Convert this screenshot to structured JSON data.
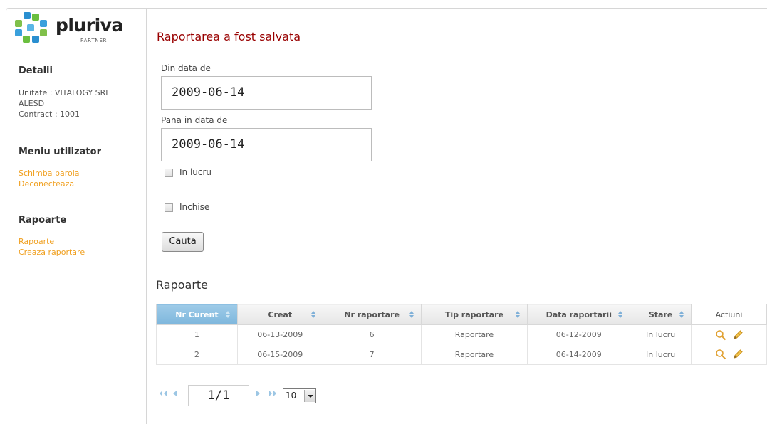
{
  "brand": {
    "name": "pluriva",
    "sub": "PARTNER"
  },
  "sidebar": {
    "details_heading": "Detalii",
    "unit_line1": "Unitate : VITALOGY SRL",
    "unit_line2": "ALESD",
    "contract": "Contract : 1001",
    "user_menu_heading": "Meniu utilizator",
    "user_menu": [
      "Schimba parola",
      "Deconecteaza"
    ],
    "reports_heading": "Rapoarte",
    "reports_menu": [
      "Rapoarte",
      "Creaza raportare"
    ]
  },
  "main": {
    "title": "Raportarea a fost salvata",
    "from_label": "Din data de",
    "from_value": "2009-06-14",
    "to_label": "Pana in data de",
    "to_value": "2009-06-14",
    "checkbox_in_progress": "In lucru",
    "checkbox_closed": "Inchise",
    "search_button": "Cauta",
    "section_title": "Rapoarte"
  },
  "table": {
    "columns": [
      "Nr Curent",
      "Creat",
      "Nr raportare",
      "Tip raportare",
      "Data raportarii",
      "Stare",
      "Actiuni"
    ],
    "rows": [
      [
        "1",
        "06-13-2009",
        "6",
        "Raportare",
        "06-12-2009",
        "In lucru"
      ],
      [
        "2",
        "06-15-2009",
        "7",
        "Raportare",
        "06-14-2009",
        "In lucru"
      ]
    ]
  },
  "pager": {
    "page": "1/1",
    "page_size": "10"
  },
  "colors": {
    "title": "#990000",
    "link": "#f0a020",
    "active_header": "#7db6dc"
  },
  "icons": [
    "pluriva-logo-icon",
    "sort-icon",
    "view-icon",
    "edit-icon",
    "first-page-icon",
    "prev-page-icon",
    "next-page-icon",
    "last-page-icon",
    "chevron-down-icon"
  ]
}
